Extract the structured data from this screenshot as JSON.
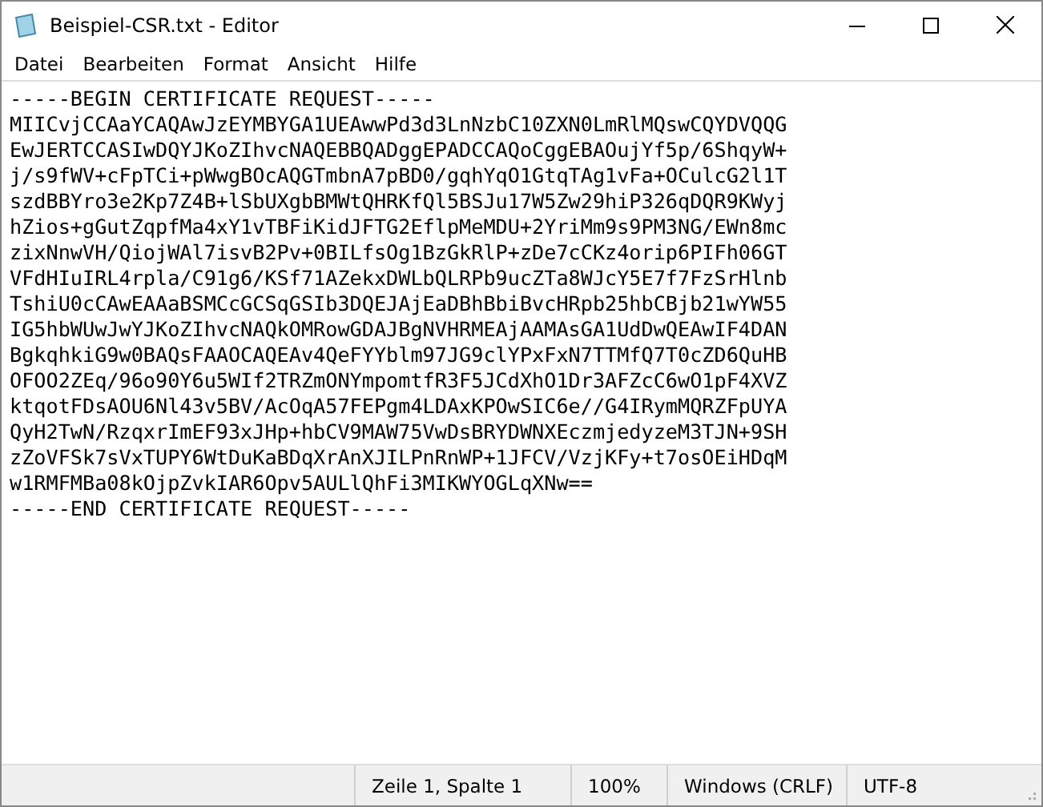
{
  "window": {
    "title": "Beispiel-CSR.txt - Editor"
  },
  "menu": [
    "Datei",
    "Bearbeiten",
    "Format",
    "Ansicht",
    "Hilfe"
  ],
  "content": {
    "lines": [
      "-----BEGIN CERTIFICATE REQUEST-----",
      "MIICvjCCAaYCAQAwJzEYMBYGA1UEAwwPd3d3LnNzbC10ZXN0LmRlMQswCQYDVQQG",
      "EwJERTCCASIwDQYJKoZIhvcNAQEBBQADggEPADCCAQoCggEBAOujYf5p/6ShqyW+",
      "j/s9fWV+cFpTCi+pWwgBOcAQGTmbnA7pBD0/gqhYqO1GtqTAg1vFa+OCulcG2l1T",
      "szdBBYro3e2Kp7Z4B+lSbUXgbBMWtQHRKfQl5BSJu17W5Zw29hiP326qDQR9KWyj",
      "hZios+gGutZqpfMa4xY1vTBFiKidJFTG2EflpMeMDU+2YriMm9s9PM3NG/EWn8mc",
      "zixNnwVH/QiojWAl7isvB2Pv+0BILfsOg1BzGkRlP+zDe7cCKz4orip6PIFh06GT",
      "VFdHIuIRL4rpla/C91g6/KSf71AZekxDWLbQLRPb9ucZTa8WJcY5E7f7FzSrHlnb",
      "TshiU0cCAwEAAaBSMCcGCSqGSIb3DQEJAjEaDBhBbiBvcHRpb25hbCBjb21wYW55",
      "IG5hbWUwJwYJKoZIhvcNAQkOMRowGDAJBgNVHRMEAjAAMAsGA1UdDwQEAwIF4DAN",
      "BgkqhkiG9w0BAQsFAAOCAQEAv4QeFYYblm97JG9clYPxFxN7TTMfQ7T0cZD6QuHB",
      "OFOO2ZEq/96o90Y6u5WIf2TRZmONYmpomtfR3F5JCdXhO1Dr3AFZcC6wO1pF4XVZ",
      "ktqotFDsAOU6Nl43v5BV/AcOqA57FEPgm4LDAxKPOwSIC6e//G4IRymMQRZFpUYA",
      "QyH2TwN/RzqxrImEF93xJHp+hbCV9MAW75VwDsBRYDWNXEczmjedyzeM3TJN+9SH",
      "zZoVFSk7sVxTUPY6WtDuKaBDqXrAnXJILPnRnWP+1JFCV/VzjKFy+t7osOEiHDqM",
      "w1RMFMBa08kOjpZvkIAR6Opv5AULlQhFi3MIKWYOGLqXNw==",
      "-----END CERTIFICATE REQUEST-----"
    ]
  },
  "status_bar": [
    "Zeile 1, Spalte 1",
    "100%",
    "Windows (CRLF)",
    "UTF-8"
  ]
}
